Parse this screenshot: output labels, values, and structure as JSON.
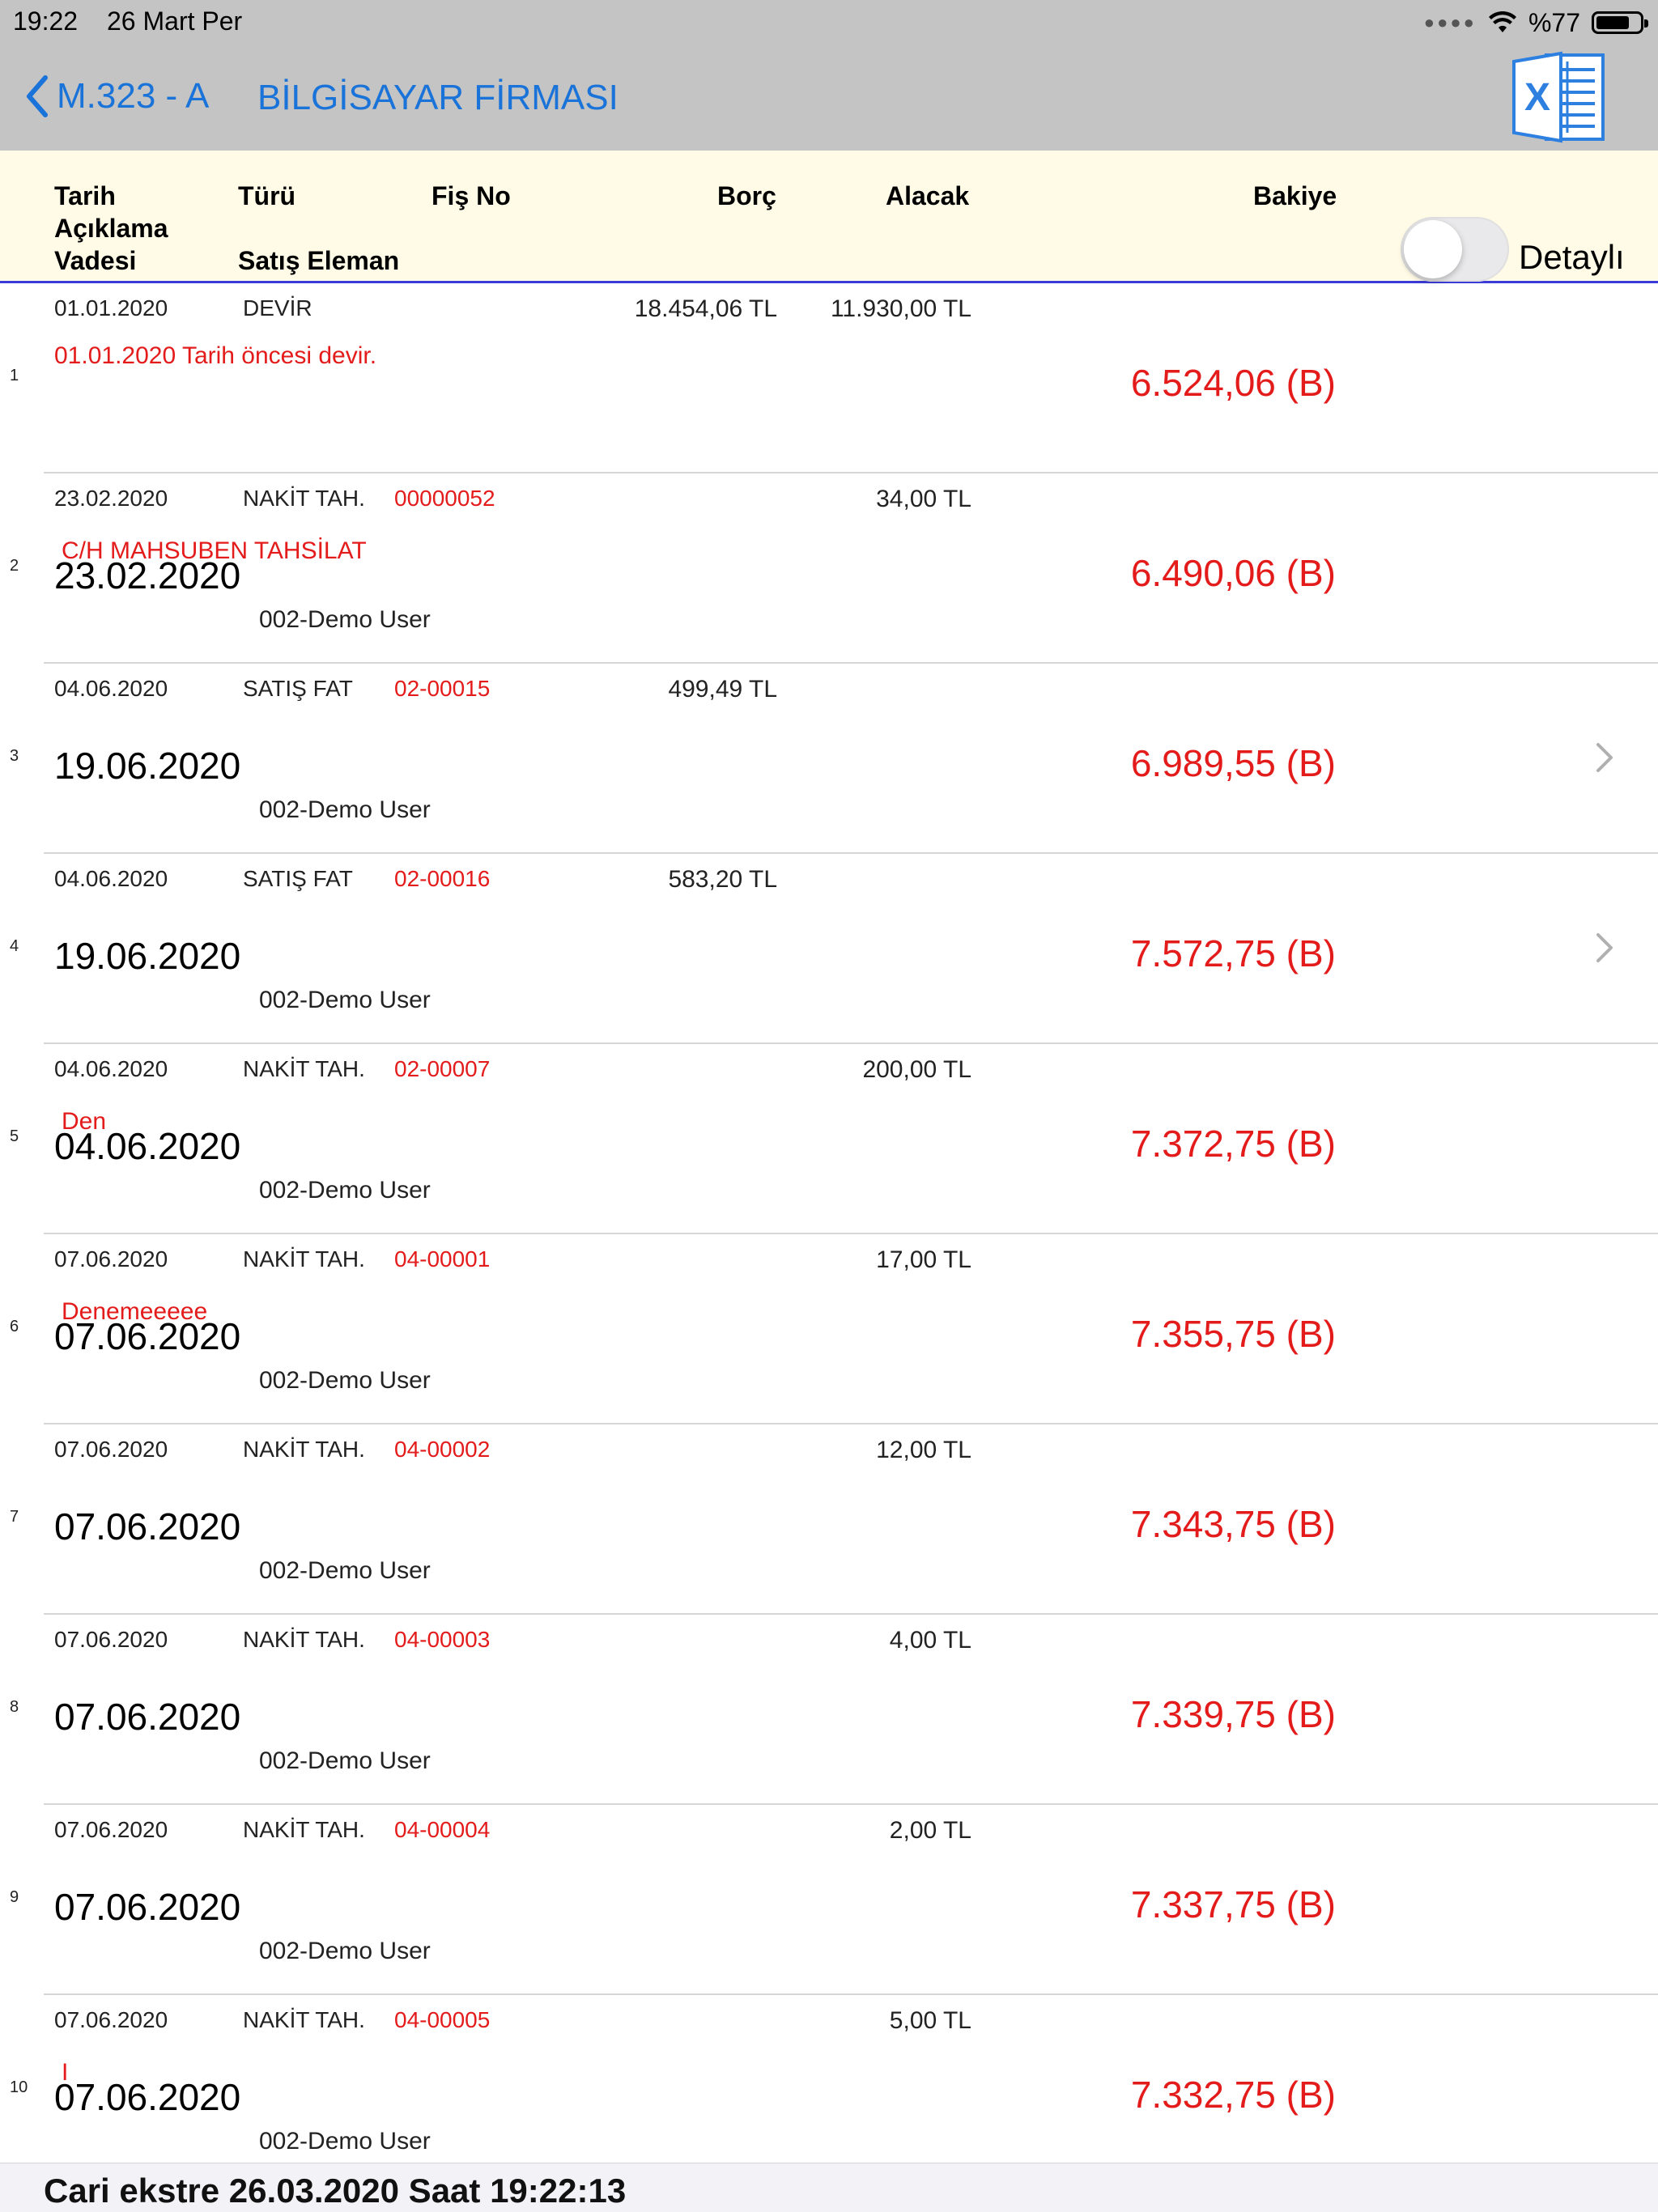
{
  "status": {
    "time": "19:22",
    "date": "26 Mart Per",
    "battery": "%77",
    "battery_level": 0.77
  },
  "nav": {
    "back_label": "M.323 - A",
    "title": "BİLGİSAYAR FİRMASI",
    "excel_icon": "excel-export-icon"
  },
  "header": {
    "tarih": "Tarih",
    "aciklama": "Açıklama",
    "vadesi": "Vadesi",
    "turu": "Türü",
    "satis_eleman": "Satış Eleman",
    "fis_no": "Fiş No",
    "borc": "Borç",
    "alacak": "Alacak",
    "bakiye": "Bakiye",
    "detay_label": "Detaylı",
    "detay_on": false
  },
  "rows": [
    {
      "no": "1",
      "date": "01.01.2020",
      "type": "DEVİR",
      "fis": "",
      "borc": "18.454,06 TL",
      "alacak": "11.930,00 TL",
      "desc": "01.01.2020 Tarih öncesi devir.",
      "vade": "",
      "seller": "",
      "bakiye": "6.524,06 (B)",
      "chevron": false
    },
    {
      "no": "2",
      "date": "23.02.2020",
      "type": "NAKİT TAH.",
      "fis": "00000052",
      "borc": "",
      "alacak": "34,00 TL",
      "desc": "C/H MAHSUBEN TAHSİLAT",
      "vade": "23.02.2020",
      "seller": "002-Demo User",
      "bakiye": "6.490,06 (B)",
      "chevron": false
    },
    {
      "no": "3",
      "date": "04.06.2020",
      "type": "SATIŞ FAT",
      "fis": "02-00015",
      "borc": "499,49 TL",
      "alacak": "",
      "desc": "",
      "vade": "19.06.2020",
      "seller": "002-Demo User",
      "bakiye": "6.989,55 (B)",
      "chevron": true
    },
    {
      "no": "4",
      "date": "04.06.2020",
      "type": "SATIŞ FAT",
      "fis": "02-00016",
      "borc": "583,20 TL",
      "alacak": "",
      "desc": "",
      "vade": "19.06.2020",
      "seller": "002-Demo User",
      "bakiye": "7.572,75 (B)",
      "chevron": true
    },
    {
      "no": "5",
      "date": "04.06.2020",
      "type": "NAKİT TAH.",
      "fis": "02-00007",
      "borc": "",
      "alacak": "200,00 TL",
      "desc": "Den",
      "vade": "04.06.2020",
      "seller": "002-Demo User",
      "bakiye": "7.372,75 (B)",
      "chevron": false
    },
    {
      "no": "6",
      "date": "07.06.2020",
      "type": "NAKİT TAH.",
      "fis": "04-00001",
      "borc": "",
      "alacak": "17,00 TL",
      "desc": "Denemeeeee",
      "vade": "07.06.2020",
      "seller": "002-Demo User",
      "bakiye": "7.355,75 (B)",
      "chevron": false
    },
    {
      "no": "7",
      "date": "07.06.2020",
      "type": "NAKİT TAH.",
      "fis": "04-00002",
      "borc": "",
      "alacak": "12,00 TL",
      "desc": "",
      "vade": "07.06.2020",
      "seller": "002-Demo User",
      "bakiye": "7.343,75 (B)",
      "chevron": false
    },
    {
      "no": "8",
      "date": "07.06.2020",
      "type": "NAKİT TAH.",
      "fis": "04-00003",
      "borc": "",
      "alacak": "4,00 TL",
      "desc": "",
      "vade": "07.06.2020",
      "seller": "002-Demo User",
      "bakiye": "7.339,75 (B)",
      "chevron": false
    },
    {
      "no": "9",
      "date": "07.06.2020",
      "type": "NAKİT TAH.",
      "fis": "04-00004",
      "borc": "",
      "alacak": "2,00 TL",
      "desc": "",
      "vade": "07.06.2020",
      "seller": "002-Demo User",
      "bakiye": "7.337,75 (B)",
      "chevron": false
    },
    {
      "no": "10",
      "date": "07.06.2020",
      "type": "NAKİT TAH.",
      "fis": "04-00005",
      "borc": "",
      "alacak": "5,00 TL",
      "desc": "I",
      "vade": "07.06.2020",
      "seller": "002-Demo User",
      "bakiye": "7.332,75 (B)",
      "chevron": false
    }
  ],
  "footer": {
    "text": "Cari ekstre  26.03.2020 Saat 19:22:13"
  },
  "colors": {
    "accent": "#1a73d9",
    "negative": "#e41b1b",
    "header_bg": "#fffbe6",
    "bar_bg": "#c4c4c4"
  }
}
